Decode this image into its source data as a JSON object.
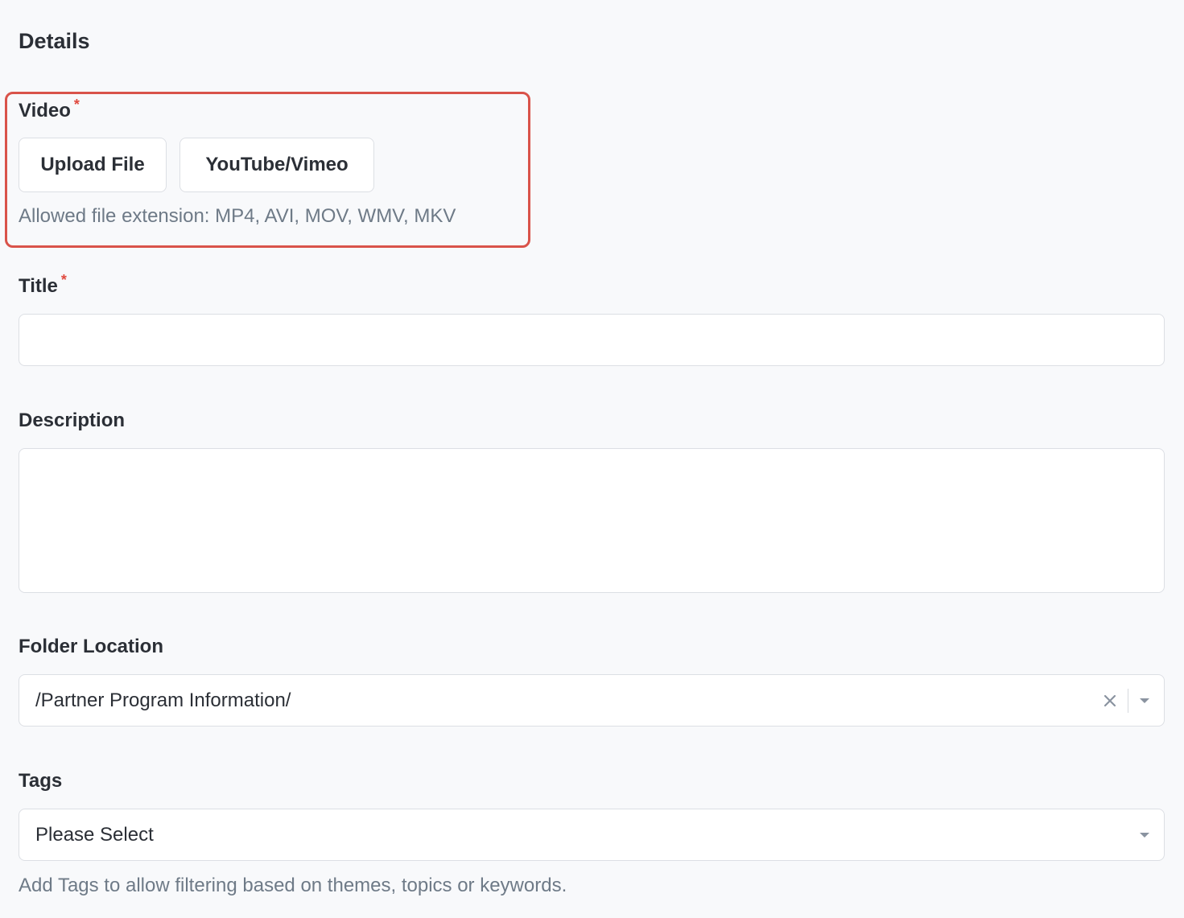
{
  "section": {
    "title": "Details"
  },
  "video": {
    "label": "Video",
    "required_mark": "*",
    "upload_button": "Upload File",
    "youtube_button": "YouTube/Vimeo",
    "help": "Allowed file extension: MP4, AVI, MOV, WMV, MKV"
  },
  "title_field": {
    "label": "Title",
    "required_mark": "*",
    "value": ""
  },
  "description_field": {
    "label": "Description",
    "value": ""
  },
  "folder": {
    "label": "Folder Location",
    "value": "/Partner Program Information/"
  },
  "tags": {
    "label": "Tags",
    "placeholder": "Please Select",
    "help": "Add Tags to allow filtering based on themes, topics or keywords."
  },
  "colors": {
    "highlight": "#d9534a",
    "required": "#e04a3f",
    "help_text": "#6e7a87"
  },
  "icons": {
    "clear": "close-icon",
    "dropdown": "caret-down-icon"
  }
}
